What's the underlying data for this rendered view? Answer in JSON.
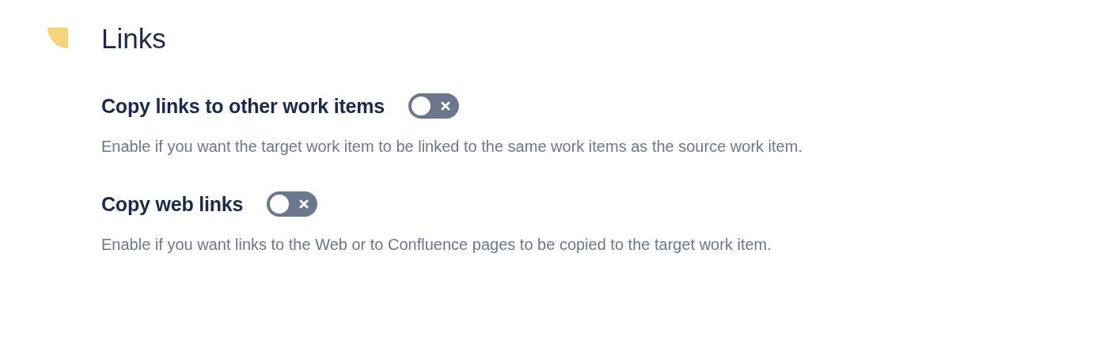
{
  "section": {
    "title": "Links"
  },
  "settings": [
    {
      "label": "Copy links to other work items",
      "on": false,
      "description": "Enable if you want the target work item to be linked to the same work items as the source work item."
    },
    {
      "label": "Copy web links",
      "on": false,
      "description": "Enable if you want links to the Web or to Confluence pages to be copied to the target work item."
    }
  ]
}
